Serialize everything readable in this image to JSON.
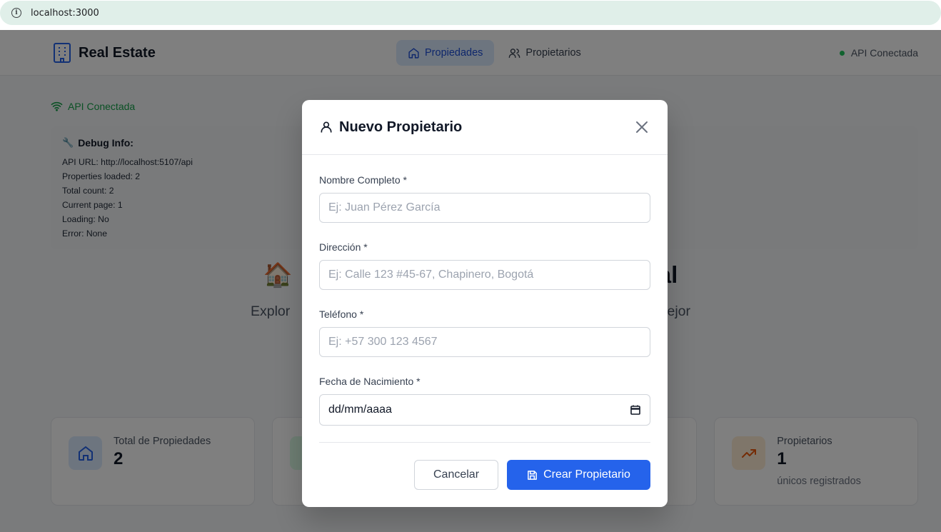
{
  "browser": {
    "url": "localhost:3000"
  },
  "header": {
    "brand": "Real Estate",
    "nav": [
      {
        "label": "Propiedades",
        "icon": "home-icon",
        "active": true
      },
      {
        "label": "Propietarios",
        "icon": "users-icon",
        "active": false
      }
    ],
    "status": "API Conectada"
  },
  "page": {
    "api_status": "API Conectada",
    "debug": {
      "title": "Debug Info:",
      "lines": [
        "API URL: http://localhost:5107/api",
        "Properties loaded: 2",
        "Total count: 2",
        "Current page: 1",
        "Loading: No",
        "Error: None"
      ]
    },
    "hero_title_left": "🏠",
    "hero_title_right": "al",
    "hero_sub_left": "Explor",
    "hero_sub_right": "mejor",
    "stats": [
      {
        "label": "Total de Propiedades",
        "value": "2",
        "sub": "",
        "icon": "home-icon",
        "icon_bg": "#dbeafe",
        "icon_color": "#2563eb"
      },
      {
        "label": "",
        "value": "",
        "sub": "",
        "icon": "",
        "icon_bg": "#dcfce7",
        "icon_color": "#16a34a"
      },
      {
        "label": "",
        "value": "",
        "sub": "",
        "icon": "",
        "icon_bg": "",
        "icon_color": ""
      },
      {
        "label": "Propietarios",
        "value": "1",
        "sub": "únicos registrados",
        "icon": "trending-up-icon",
        "icon_bg": "#ffedd5",
        "icon_color": "#ea580c"
      }
    ]
  },
  "modal": {
    "title": "Nuevo Propietario",
    "fields": [
      {
        "label": "Nombre Completo *",
        "placeholder": "Ej: Juan Pérez García"
      },
      {
        "label": "Dirección *",
        "placeholder": "Ej: Calle 123 #45-67, Chapinero, Bogotá"
      },
      {
        "label": "Teléfono *",
        "placeholder": "Ej: +57 300 123 4567"
      },
      {
        "label": "Fecha de Nacimiento *",
        "placeholder": "dd/mm/aaaa"
      }
    ],
    "cancel_label": "Cancelar",
    "submit_label": "Crear Propietario"
  },
  "colors": {
    "primary": "#2563eb",
    "success": "#22c55e"
  }
}
